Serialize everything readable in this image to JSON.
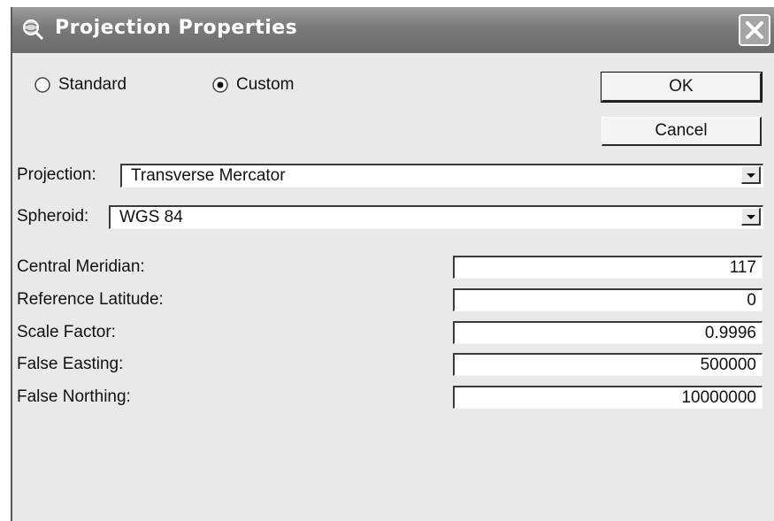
{
  "window": {
    "title": "Projection Properties",
    "title_icon": "globe-magnifier-icon",
    "close_icon": "close-icon"
  },
  "mode": {
    "options": [
      "Standard",
      "Custom"
    ],
    "selected": "Custom"
  },
  "buttons": {
    "ok": "OK",
    "cancel": "Cancel"
  },
  "projection": {
    "label": "Projection:",
    "value": "Transverse Mercator"
  },
  "spheroid": {
    "label": "Spheroid:",
    "value": "WGS 84"
  },
  "parameters": [
    {
      "label": "Central Meridian:",
      "value": "117"
    },
    {
      "label": "Reference Latitude:",
      "value": "0"
    },
    {
      "label": "Scale Factor:",
      "value": "0.9996"
    },
    {
      "label": "False Easting:",
      "value": "500000"
    },
    {
      "label": "False Northing:",
      "value": "10000000"
    }
  ]
}
